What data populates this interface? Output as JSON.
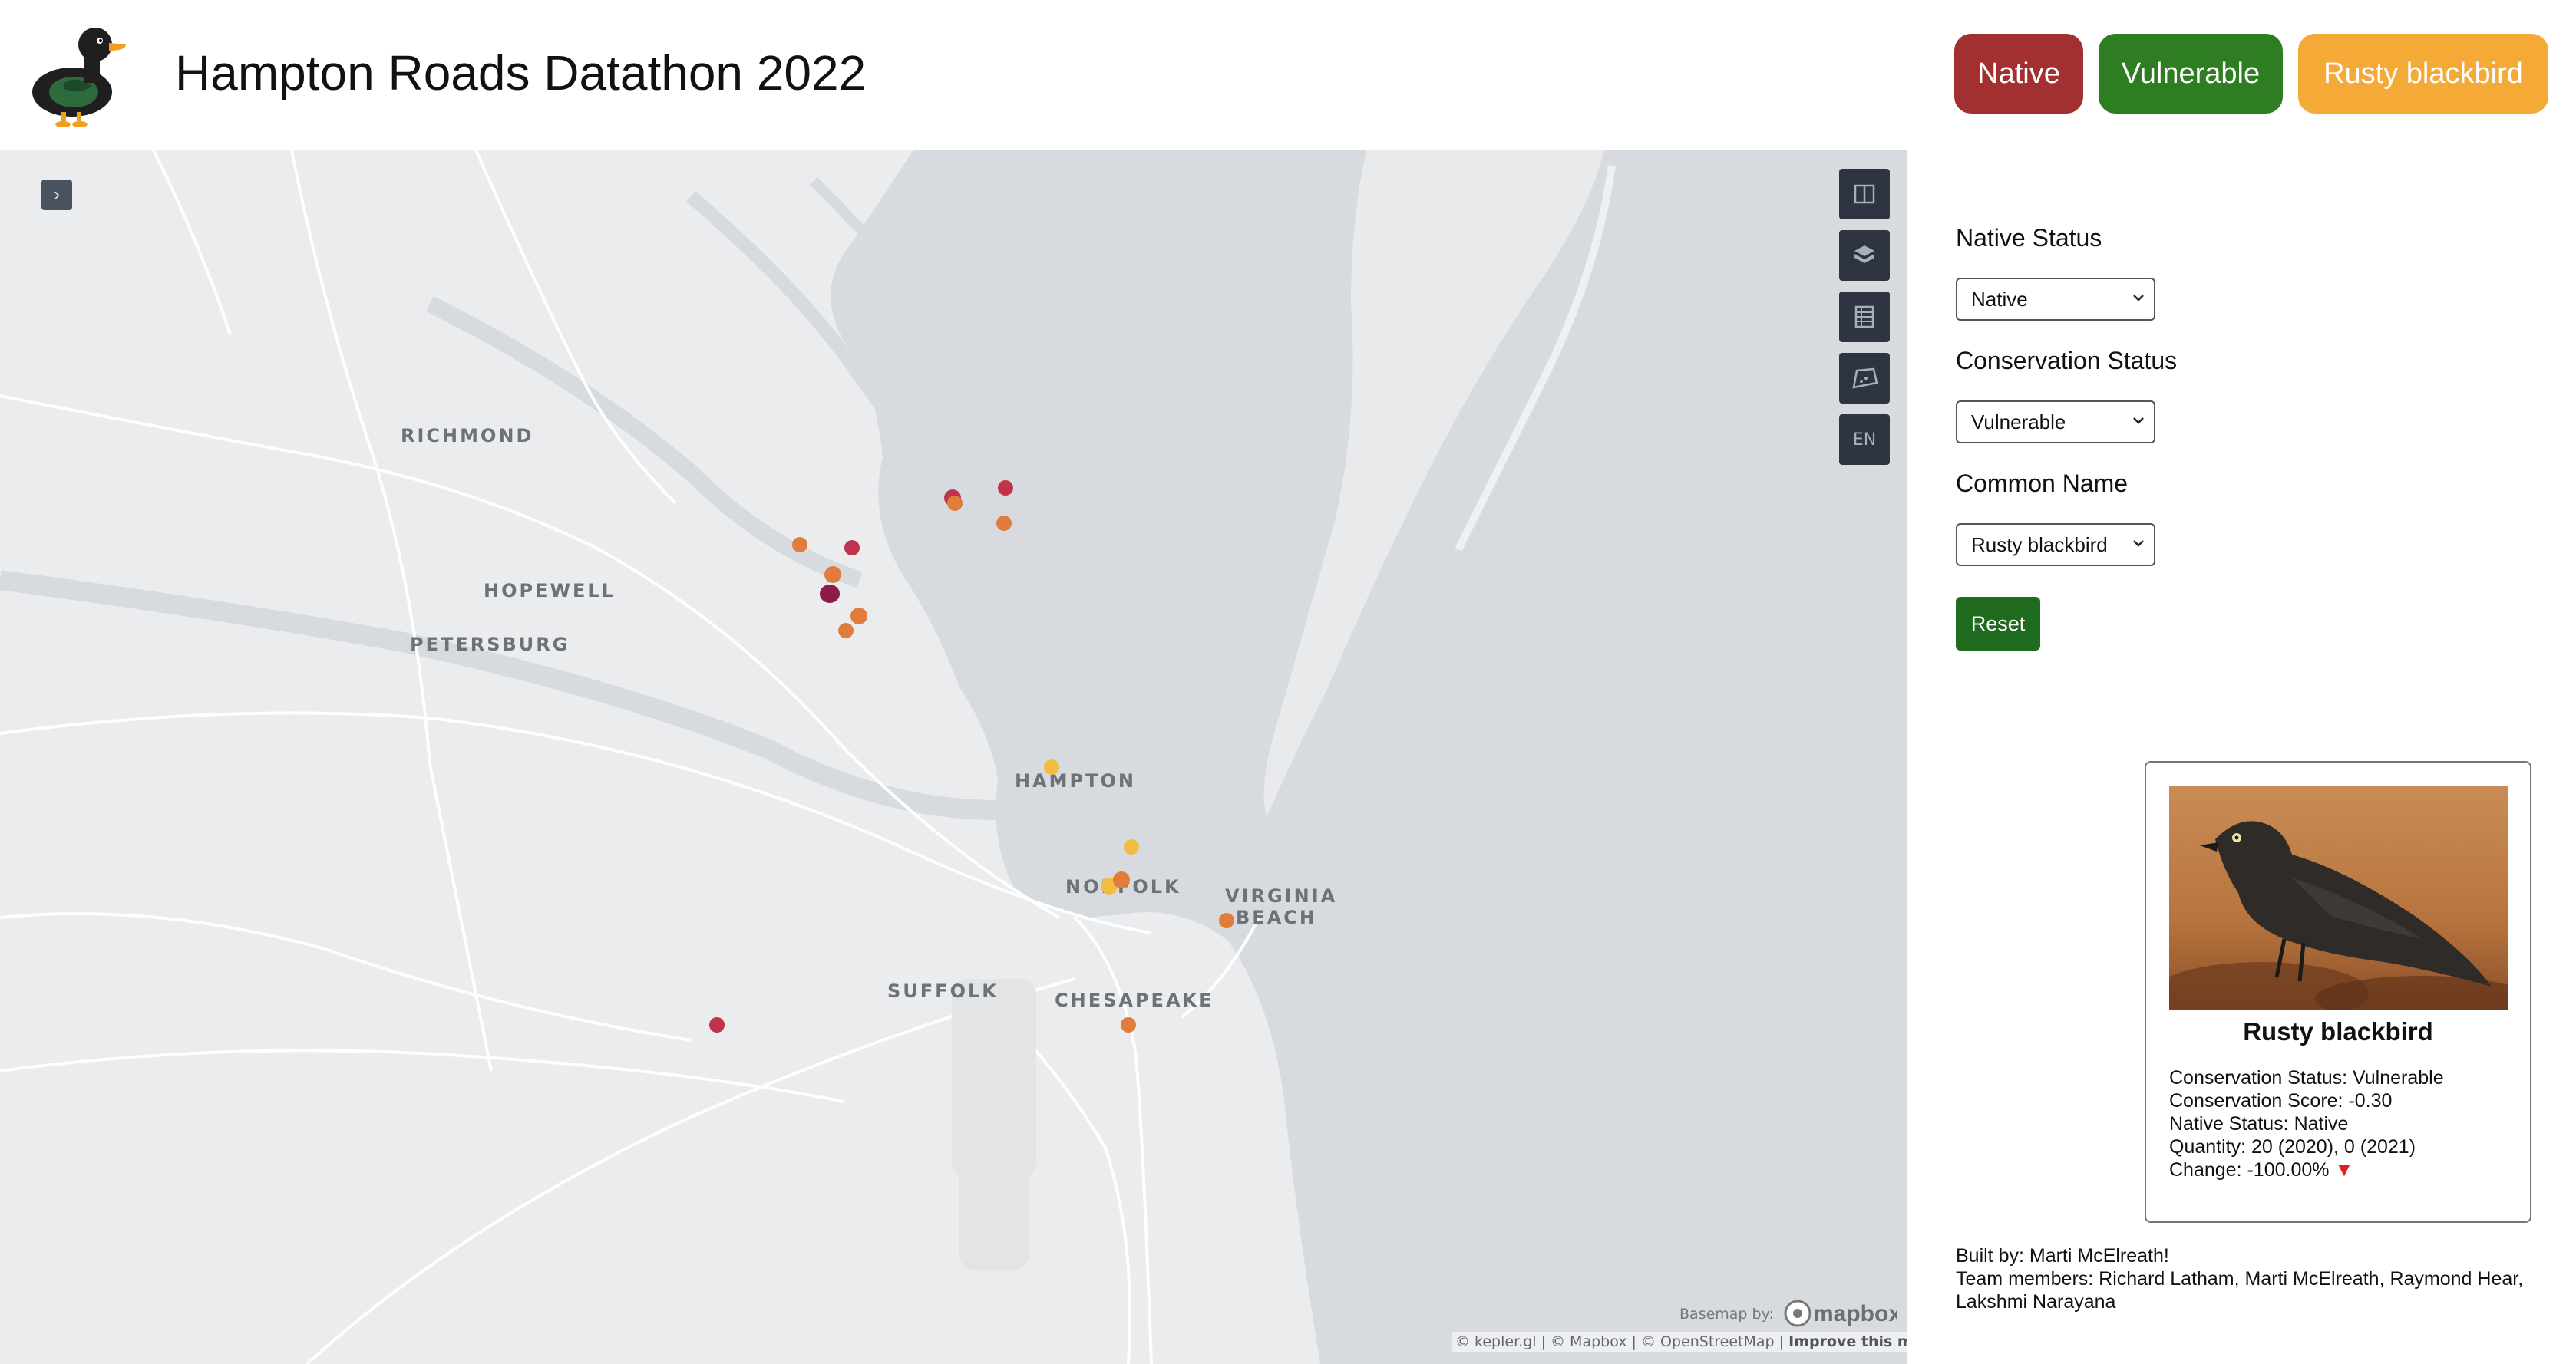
{
  "header": {
    "title": "Hampton Roads Datathon 2022",
    "chips": [
      {
        "label": "Native",
        "color": "#a23030"
      },
      {
        "label": "Vulnerable",
        "color": "#2e7d22"
      },
      {
        "label": "Rusty blackbird",
        "color": "#f5a937"
      }
    ]
  },
  "map": {
    "places": [
      "RICHMOND",
      "HOPEWELL",
      "PETERSBURG",
      "HAMPTON",
      "NORFOLK",
      "VIRGINIA",
      "BEACH",
      "SUFFOLK",
      "CHESAPEAKE"
    ],
    "controls": {
      "sidebar_toggle": "›",
      "split": "split-map-icon",
      "perspective": "3d-perspective-icon",
      "legend": "legend-icon",
      "draw": "draw-polygon-icon",
      "language": "EN"
    },
    "basemap_by": "Basemap by:",
    "mapbox": "mapbox",
    "attribution": {
      "text": "© kepler.gl | © Mapbox | © OpenStreetMap | ",
      "improve": "Improve this map"
    },
    "point_colors": {
      "dark": "#8e1a47",
      "red": "#c1334a",
      "orange": "#e07d3a",
      "yellow": "#f2bd40"
    }
  },
  "filters": {
    "native_status": {
      "label": "Native Status",
      "value": "Native"
    },
    "conservation_status": {
      "label": "Conservation Status",
      "value": "Vulnerable"
    },
    "common_name": {
      "label": "Common Name",
      "value": "Rusty blackbird"
    },
    "reset_label": "Reset"
  },
  "card": {
    "name": "Rusty blackbird",
    "conservation_status": "Conservation Status: Vulnerable",
    "conservation_score": "Conservation Score: -0.30",
    "native_status": "Native Status: Native",
    "quantity": "Quantity: 20 (2020), 0 (2021)",
    "change": "Change: -100.00%",
    "change_arrow": "▼"
  },
  "credits": {
    "built_by": "Built by: Marti McElreath!",
    "team": "Team members: Richard Latham, Marti McElreath, Raymond Hear, Lakshmi Narayana"
  }
}
